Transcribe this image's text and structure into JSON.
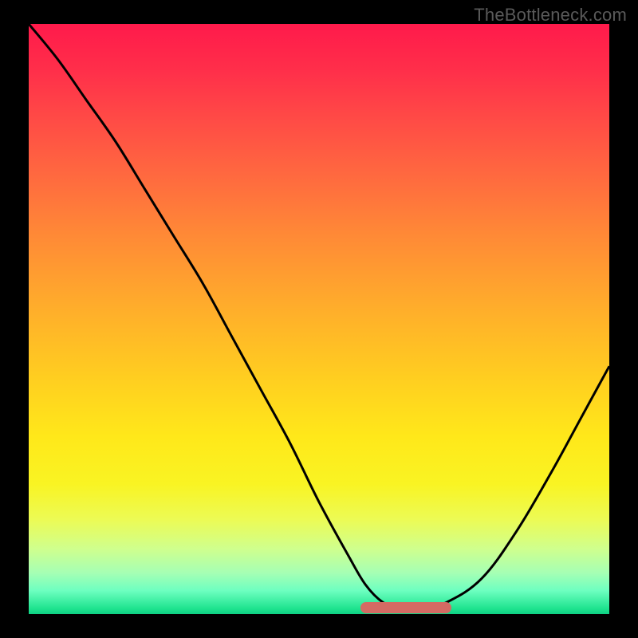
{
  "watermark": "TheBottleneck.com",
  "colors": {
    "curve_stroke": "#000000",
    "marker_fill": "#d46a63",
    "frame_bg": "#000000"
  },
  "chart_data": {
    "type": "line",
    "title": "",
    "xlabel": "",
    "ylabel": "",
    "xlim": [
      0,
      100
    ],
    "ylim": [
      0,
      100
    ],
    "grid": false,
    "legend": false,
    "series": [
      {
        "name": "bottleneck-curve",
        "x": [
          0,
          5,
          10,
          15,
          20,
          25,
          30,
          35,
          40,
          45,
          50,
          55,
          58,
          61,
          64,
          68,
          72,
          78,
          84,
          90,
          95,
          100
        ],
        "values": [
          100,
          94,
          87,
          80,
          72,
          64,
          56,
          47,
          38,
          29,
          19,
          10,
          5,
          2,
          1,
          1,
          2,
          6,
          14,
          24,
          33,
          42
        ]
      }
    ],
    "flat_region": {
      "x_start": 58,
      "x_end": 72,
      "y": 1
    },
    "note": "Values estimated visually from pixel positions; 0 = bottom (green), 100 = top (red)."
  }
}
